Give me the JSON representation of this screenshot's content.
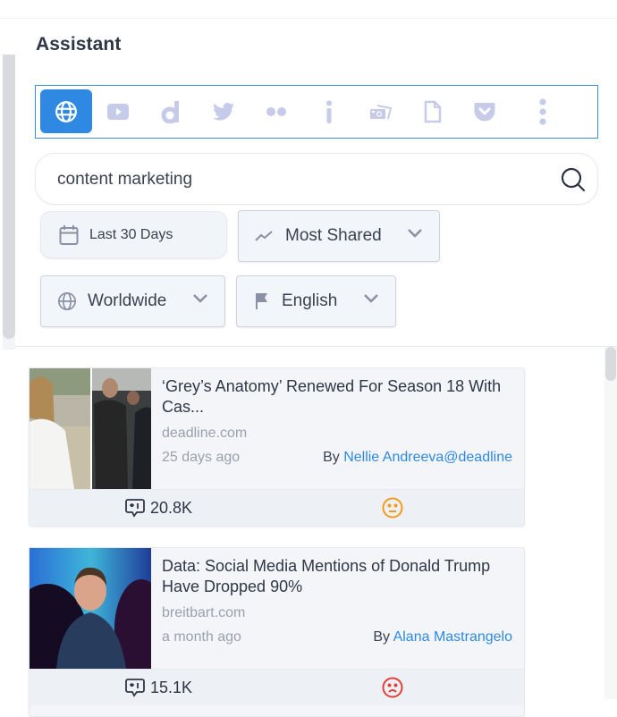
{
  "panel": {
    "title": "Assistant"
  },
  "sources": [
    {
      "name": "web",
      "icon": "globe-icon",
      "active": true
    },
    {
      "name": "youtube",
      "icon": "youtube-icon",
      "active": false
    },
    {
      "name": "dailymotion",
      "icon": "dailymotion-icon",
      "active": false
    },
    {
      "name": "twitter",
      "icon": "twitter-icon",
      "active": false
    },
    {
      "name": "flickr",
      "icon": "flickr-icon",
      "active": false
    },
    {
      "name": "info",
      "icon": "info-icon",
      "active": false
    },
    {
      "name": "photos",
      "icon": "photos-icon",
      "active": false
    },
    {
      "name": "document",
      "icon": "document-icon",
      "active": false
    },
    {
      "name": "pocket",
      "icon": "pocket-icon",
      "active": false
    },
    {
      "name": "more",
      "icon": "more-vertical-icon",
      "active": false
    }
  ],
  "search": {
    "value": "content marketing",
    "placeholder": ""
  },
  "filters": {
    "date_range": "Last 30 Days",
    "sort": "Most Shared",
    "region": "Worldwide",
    "language": "English"
  },
  "articles": [
    {
      "headline": "‘Grey’s Anatomy’ Renewed For Season 18 With Cas...",
      "domain": "deadline.com",
      "age": "25 days ago",
      "by_label": "By",
      "author": "Nellie Andreeva@deadline",
      "shares": "20.8K",
      "sentiment": "neutral",
      "sentiment_color": "#f59a1b"
    },
    {
      "headline": "Data: Social Media Mentions of Donald Trump Have Dropped 90%",
      "domain": "breitbart.com",
      "age": "a month ago",
      "by_label": "By",
      "author": "Alana Mastrangelo",
      "shares": "15.1K",
      "sentiment": "negative",
      "sentiment_color": "#e0413a"
    }
  ],
  "colors": {
    "accent": "#2f89e3",
    "icon_muted": "#c5cbe8"
  }
}
